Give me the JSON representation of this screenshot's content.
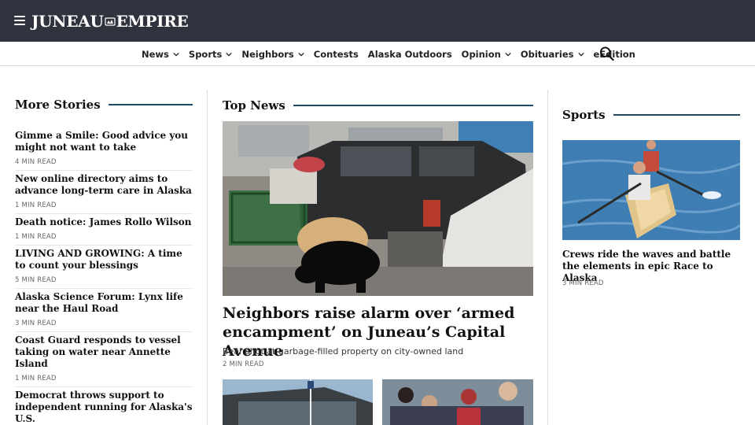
{
  "header": {
    "logo_left": "JUNEAU",
    "logo_right": "EMPIRE",
    "bg_color": "#30333d"
  },
  "nav": {
    "items": [
      {
        "label": "News",
        "dropdown": true
      },
      {
        "label": "Sports",
        "dropdown": true
      },
      {
        "label": "Neighbors",
        "dropdown": true
      },
      {
        "label": "Contests",
        "dropdown": false
      },
      {
        "label": "Alaska Outdoors",
        "dropdown": false
      },
      {
        "label": "Opinion",
        "dropdown": true
      },
      {
        "label": "Obituaries",
        "dropdown": true
      },
      {
        "label": "eEdition",
        "dropdown": false
      }
    ],
    "search_icon": "search-icon"
  },
  "more_stories": {
    "title": "More Stories",
    "items": [
      {
        "headline": "Gimme a Smile: Good advice you might not want to take",
        "meta": "4 MIN READ"
      },
      {
        "headline": "New online directory aims to advance long-term care in Alaska",
        "meta": "1 MIN READ"
      },
      {
        "headline": "Death notice: James Rollo Wilson",
        "meta": "1 MIN READ"
      },
      {
        "headline": "LIVING AND GROWING: A time to count your blessings",
        "meta": "5 MIN READ"
      },
      {
        "headline": "Alaska Science Forum: Lynx life near the Haul Road",
        "meta": "3 MIN READ"
      },
      {
        "headline": "Coast Guard responds to vessel taking on water near Annette Island",
        "meta": "1 MIN READ"
      },
      {
        "headline": "Democrat throws support to independent running for Alaska's U.S.",
        "meta": ""
      }
    ]
  },
  "top_news": {
    "title": "Top News",
    "headline": "Neighbors raise alarm over ‘armed encampment’ on Juneau’s Capital Avenue",
    "dek": "Bear shot at garbage-filled property on city-owned land",
    "meta": "2 MIN READ"
  },
  "sports": {
    "title": "Sports",
    "headline": "Crews ride the waves and battle the elements in epic Race to Alaska",
    "meta": "3 MIN READ"
  },
  "colors": {
    "accent_rule": "#1f4a66",
    "divider": "#dcdcdc"
  }
}
